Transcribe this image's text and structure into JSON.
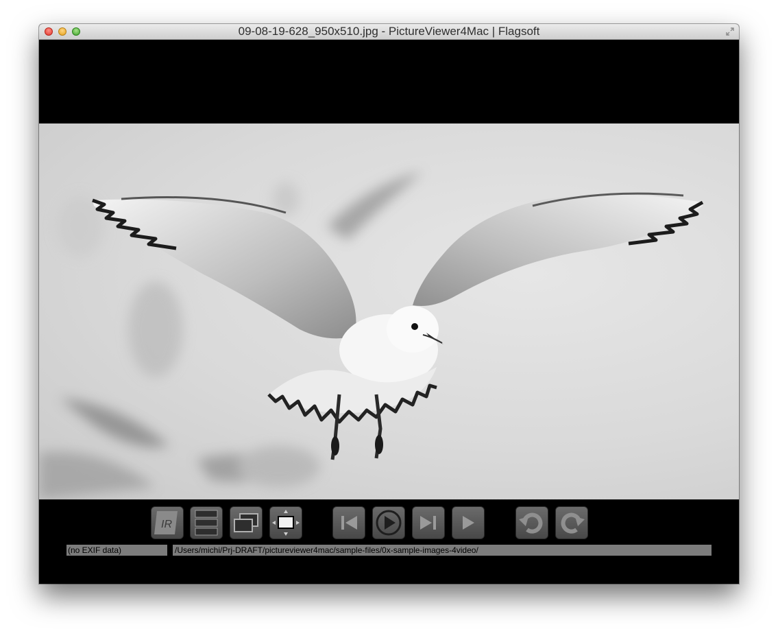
{
  "window": {
    "title": "09-08-19-628_950x510.jpg - PictureViewer4Mac | Flagsoft"
  },
  "viewer": {
    "image_description_icon": "seagull-photo"
  },
  "toolbar": {
    "buttons": [
      {
        "name": "ir-button",
        "icon": "ir-icon"
      },
      {
        "name": "thumbnails-button",
        "icon": "stacked-list-icon"
      },
      {
        "name": "windows-button",
        "icon": "overlapping-windows-icon"
      },
      {
        "name": "fit-screen-button",
        "icon": "fit-screen-icon"
      },
      {
        "name": "first-image-button",
        "icon": "skip-back-icon"
      },
      {
        "name": "slideshow-button",
        "icon": "play-circle-icon"
      },
      {
        "name": "last-image-button",
        "icon": "skip-forward-icon"
      },
      {
        "name": "next-image-button",
        "icon": "play-icon"
      },
      {
        "name": "rotate-left-button",
        "icon": "rotate-left-icon"
      },
      {
        "name": "rotate-right-button",
        "icon": "rotate-right-icon"
      }
    ]
  },
  "status": {
    "exif": "(no EXIF data)",
    "path": "/Users/michi/Prj-DRAFT/pictureviewer4mac/sample-files/0x-sample-images-4video/"
  },
  "colors": {
    "window_bg": "#000000",
    "button_bg": "#5a5a5a",
    "field_bg": "#7c7c7c"
  }
}
